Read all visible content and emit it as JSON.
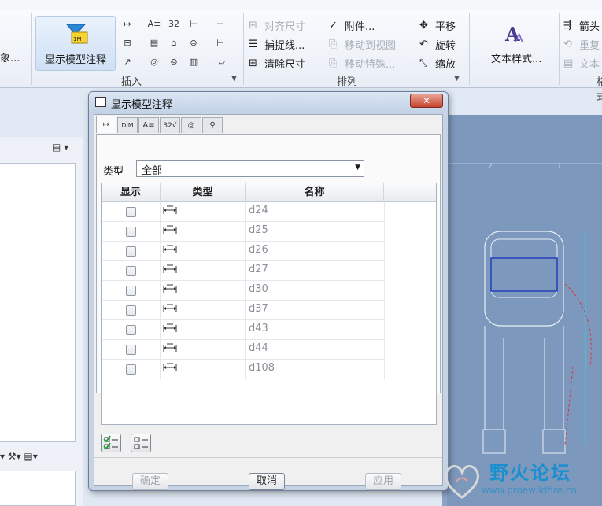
{
  "ribbon": {
    "big_button_label": "显示模型注释",
    "left_cut_text": "象...",
    "tools_col1": [
      "↦",
      "A≡",
      "32",
      "⊣"
    ],
    "arrange_tools": [
      {
        "label": "对齐尺寸",
        "disabled": true
      },
      {
        "label": "附件...",
        "disabled": false
      },
      {
        "label": "平移",
        "disabled": false
      },
      {
        "label": "捕捉线...",
        "disabled": false
      },
      {
        "label": "移动到视图",
        "disabled": true
      },
      {
        "label": "旋转",
        "disabled": false
      },
      {
        "label": "清除尺寸",
        "disabled": false
      },
      {
        "label": "移动特殊...",
        "disabled": true
      },
      {
        "label": "缩放",
        "disabled": false
      }
    ],
    "text_style_label": "文本样式...",
    "right_tools": [
      {
        "label": "箭头",
        "disabled": false
      },
      {
        "label": "重复",
        "disabled": true
      },
      {
        "label": "文本",
        "disabled": true
      }
    ],
    "group_labels": {
      "insert": "插入",
      "arrange": "排列",
      "format": "格式"
    }
  },
  "dialog": {
    "title": "显示模型注释",
    "close_label": "✕",
    "tabs": [
      "↦",
      "DIM",
      "A≡",
      "32√",
      "◎",
      "♀"
    ],
    "type_label": "类型",
    "type_value": "全部",
    "columns": [
      "显示",
      "类型",
      "名称"
    ],
    "rows": [
      {
        "name": "d24",
        "checked": false
      },
      {
        "name": "d25",
        "checked": false
      },
      {
        "name": "d26",
        "checked": false
      },
      {
        "name": "d27",
        "checked": false
      },
      {
        "name": "d30",
        "checked": false
      },
      {
        "name": "d37",
        "checked": false
      },
      {
        "name": "d43",
        "checked": false
      },
      {
        "name": "d44",
        "checked": false
      },
      {
        "name": "d108",
        "checked": false
      }
    ],
    "buttons": {
      "ok": "确定",
      "cancel": "取消",
      "apply": "应用"
    }
  },
  "watermark": {
    "title": "野火论坛",
    "url": "www.proewildfire.cn"
  },
  "colors": {
    "canvas": "#7d98bd",
    "accent": "#1a8fd0",
    "close": "#c7432d"
  }
}
